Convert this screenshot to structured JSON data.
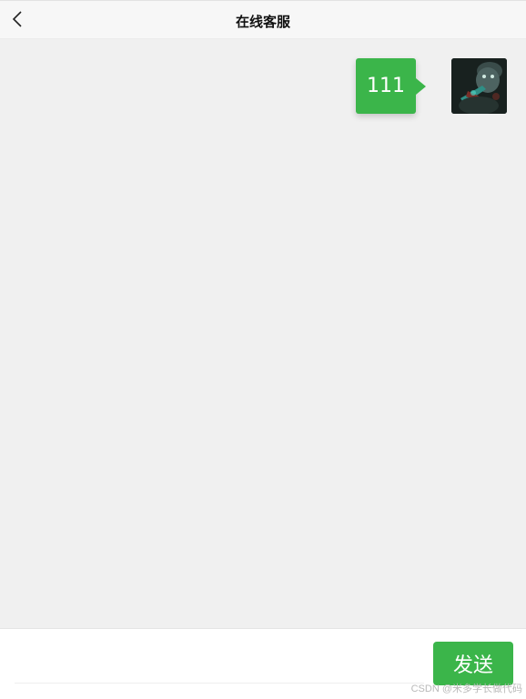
{
  "header": {
    "title": "在线客服",
    "back_icon": "chevron-left-icon"
  },
  "messages": [
    {
      "text": "111",
      "sender": "self",
      "bubble_color": "#3bb54a"
    }
  ],
  "input": {
    "value": "",
    "placeholder": "",
    "send_label": "发送"
  },
  "watermark": "CSDN @米多学长做代码",
  "colors": {
    "accent": "#3bb54a",
    "background": "#f0f0f0",
    "header_bg": "#f7f7f7"
  }
}
